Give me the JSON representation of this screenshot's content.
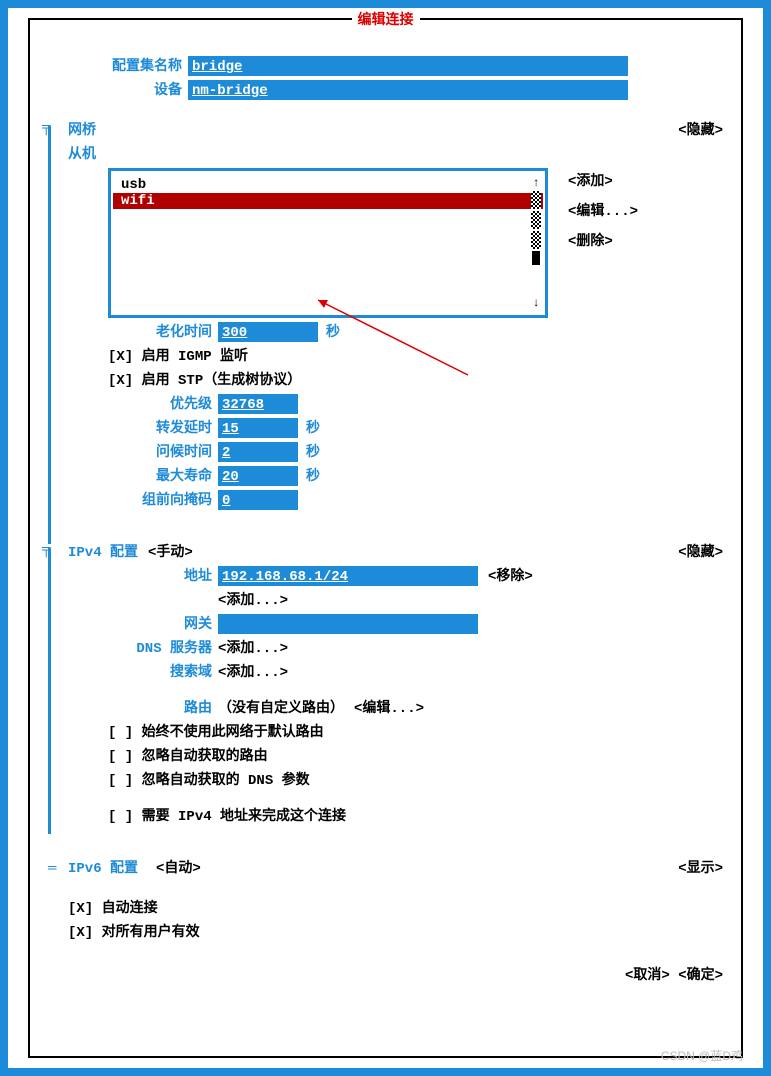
{
  "title": "编辑连接",
  "profile": {
    "name_label": "配置集名称",
    "name_value": "bridge",
    "device_label": "设备",
    "device_value": "nm-bridge"
  },
  "bridge": {
    "section_label": "网桥",
    "hide_btn": "<隐藏>",
    "slaves_label": "从机",
    "slaves": [
      "usb",
      "wifi"
    ],
    "add_btn": "<添加>",
    "edit_btn": "<编辑...>",
    "delete_btn": "<删除>",
    "aging_label": "老化时间",
    "aging_value": "300",
    "aging_unit": "秒",
    "igmp_label": "启用 IGMP 监听",
    "stp_label": "启用 STP（生成树协议）",
    "priority_label": "优先级",
    "priority_value": "32768",
    "fwd_delay_label": "转发延时",
    "fwd_delay_value": "15",
    "fwd_delay_unit": "秒",
    "hello_label": "问候时间",
    "hello_value": "2",
    "hello_unit": "秒",
    "max_age_label": "最大寿命",
    "max_age_value": "20",
    "max_age_unit": "秒",
    "group_mask_label": "组前向掩码",
    "group_mask_value": "0"
  },
  "ipv4": {
    "section_label": "IPv4 配置",
    "mode": "<手动>",
    "hide_btn": "<隐藏>",
    "address_label": "地址",
    "address_value": "192.168.68.1/24",
    "remove_btn": "<移除>",
    "add_btn": "<添加...>",
    "gateway_label": "网关",
    "gateway_value": "",
    "dns_label": "DNS 服务器",
    "dns_add": "<添加...>",
    "search_label": "搜索域",
    "search_add": "<添加...>",
    "routes_label": "路由",
    "routes_none": "（没有自定义路由）",
    "routes_edit": "<编辑...>",
    "never_default": "始终不使用此网络于默认路由",
    "ignore_routes": "忽略自动获取的路由",
    "ignore_dns": "忽略自动获取的 DNS 参数",
    "require_ipv4": "需要 IPv4 地址来完成这个连接"
  },
  "ipv6": {
    "section_label": "IPv6 配置",
    "mode": "<自动>",
    "show_btn": "<显示>"
  },
  "general": {
    "auto_connect": "自动连接",
    "all_users": "对所有用户有效"
  },
  "footer": {
    "cancel": "<取消>",
    "ok": "<确定>"
  },
  "watermark": "CSDN @蓝D鸡"
}
